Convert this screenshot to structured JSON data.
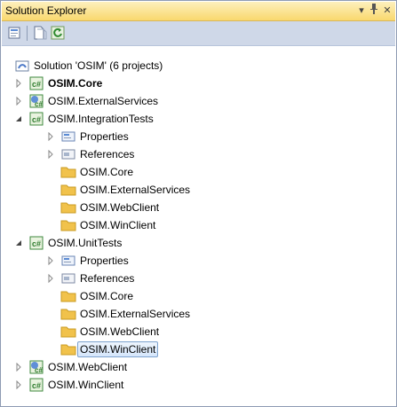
{
  "window": {
    "title": "Solution Explorer",
    "buttons": {
      "dropdown": "▾",
      "pin": "ᵩ",
      "close": "✕"
    }
  },
  "toolbar": {
    "items": [
      "properties-icon",
      "show-all-files-icon",
      "refresh-icon"
    ]
  },
  "tree": {
    "solution": "Solution 'OSIM' (6 projects)",
    "nodes": [
      {
        "label": "OSIM.Core",
        "type": "project-cs",
        "bold": true,
        "expanded": false
      },
      {
        "label": "OSIM.ExternalServices",
        "type": "project-cs",
        "expanded": false
      },
      {
        "label": "OSIM.IntegrationTests",
        "type": "project-cs",
        "expanded": true,
        "children": [
          {
            "label": "Properties",
            "type": "properties"
          },
          {
            "label": "References",
            "type": "references"
          },
          {
            "label": "OSIM.Core",
            "type": "folder"
          },
          {
            "label": "OSIM.ExternalServices",
            "type": "folder"
          },
          {
            "label": "OSIM.WebClient",
            "type": "folder"
          },
          {
            "label": "OSIM.WinClient",
            "type": "folder"
          }
        ]
      },
      {
        "label": "OSIM.UnitTests",
        "type": "project-cs",
        "expanded": true,
        "children": [
          {
            "label": "Properties",
            "type": "properties"
          },
          {
            "label": "References",
            "type": "references"
          },
          {
            "label": "OSIM.Core",
            "type": "folder"
          },
          {
            "label": "OSIM.ExternalServices",
            "type": "folder"
          },
          {
            "label": "OSIM.WebClient",
            "type": "folder"
          },
          {
            "label": "OSIM.WinClient",
            "type": "folder",
            "selected": true
          }
        ]
      },
      {
        "label": "OSIM.WebClient",
        "type": "project-web",
        "expanded": false
      },
      {
        "label": "OSIM.WinClient",
        "type": "project-cs",
        "expanded": false
      }
    ]
  },
  "colors": {
    "titlebar": "#f9d86e",
    "toolbar": "#cfd8e8",
    "selection": "#d5e6fb",
    "folder": "#f1c24b"
  }
}
